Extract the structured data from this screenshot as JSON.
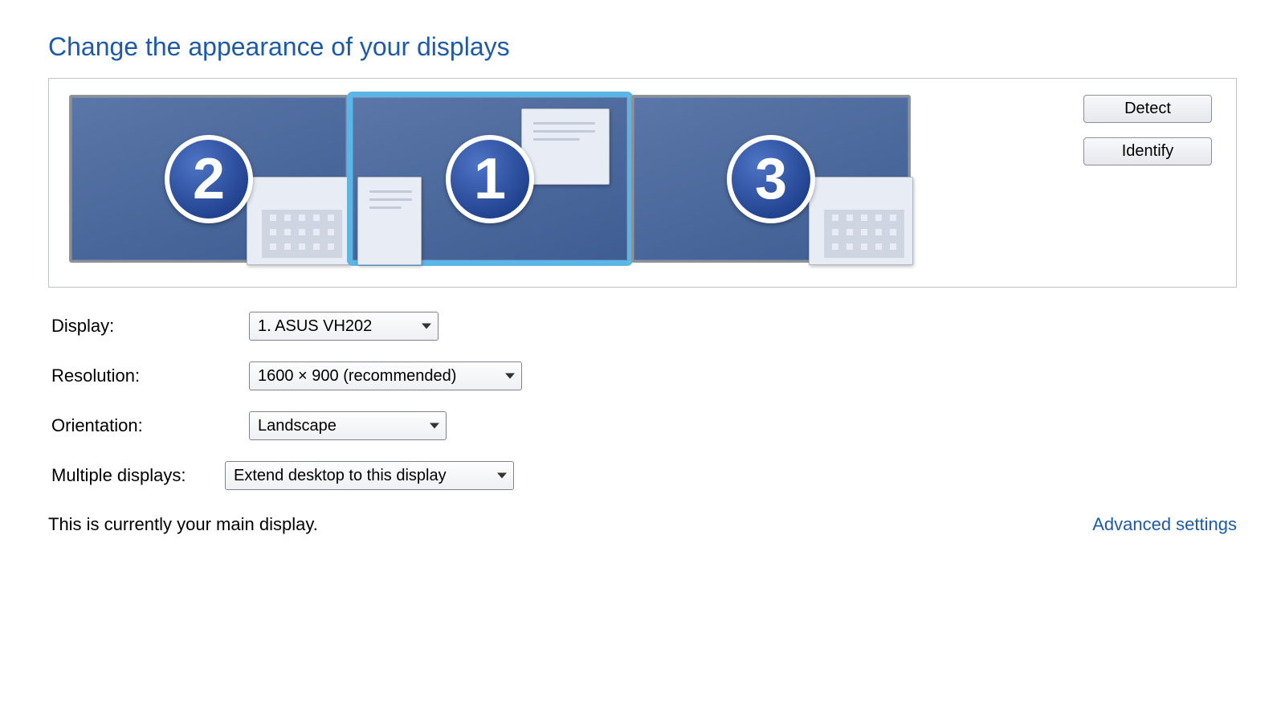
{
  "heading": "Change the appearance of your displays",
  "monitors": [
    {
      "number": "2",
      "selected": false
    },
    {
      "number": "1",
      "selected": true
    },
    {
      "number": "3",
      "selected": false
    }
  ],
  "buttons": {
    "detect": "Detect",
    "identify": "Identify"
  },
  "form": {
    "display_label": "Display:",
    "display_value": "1. ASUS VH202",
    "resolution_label": "Resolution:",
    "resolution_value": "1600 × 900 (recommended)",
    "orientation_label": "Orientation:",
    "orientation_value": "Landscape",
    "multiple_label": "Multiple displays:",
    "multiple_value": "Extend desktop to this display"
  },
  "status_text": "This is currently your main display.",
  "advanced_link": "Advanced settings"
}
